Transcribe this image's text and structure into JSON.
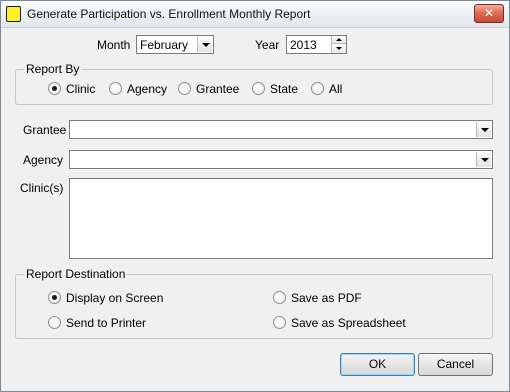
{
  "window": {
    "title": "Generate Participation vs. Enrollment Monthly Report",
    "close_glyph": "✕",
    "icon": "app-icon"
  },
  "period": {
    "month_label": "Month",
    "month_value": "February",
    "year_label": "Year",
    "year_value": "2013"
  },
  "report_by": {
    "title": "Report By",
    "options": [
      "Clinic",
      "Agency",
      "Grantee",
      "State",
      "All"
    ],
    "selected": "Clinic"
  },
  "filters": {
    "grantee_label": "Grantee",
    "grantee_value": "",
    "agency_label": "Agency",
    "agency_value": "",
    "clinics_label": "Clinic(s)"
  },
  "destination": {
    "title": "Report Destination",
    "options": [
      "Display on Screen",
      "Save as PDF",
      "Send to Printer",
      "Save as Spreadsheet"
    ],
    "selected": "Display on Screen"
  },
  "buttons": {
    "ok": "OK",
    "cancel": "Cancel"
  },
  "colors": {
    "window_bg": "#f0f0f0",
    "close_button": "#c44a33",
    "app_icon": "#ffef2a"
  }
}
